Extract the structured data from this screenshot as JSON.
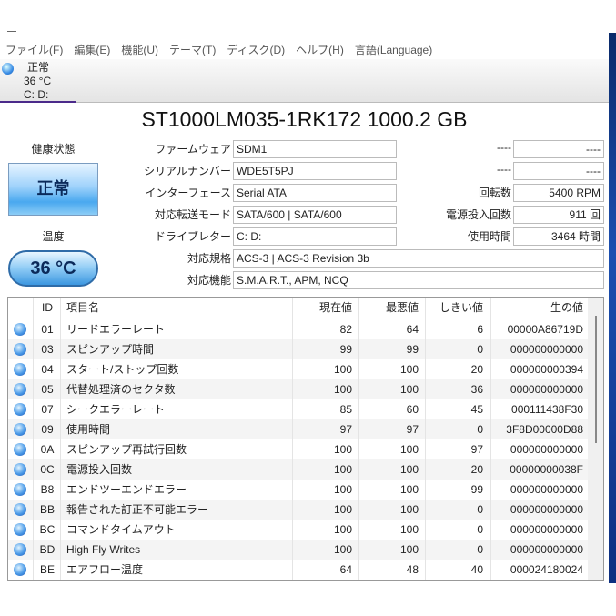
{
  "menu": [
    "ファイル(F)",
    "編集(E)",
    "機能(U)",
    "テーマ(T)",
    "ディスク(D)",
    "ヘルプ(H)",
    "言語(Language)"
  ],
  "disk_tab": {
    "status": "正常",
    "temp": "36 °C",
    "drives": "C: D:"
  },
  "model": "ST1000LM035-1RK172 1000.2 GB",
  "health": {
    "label": "健康状態",
    "value": "正常",
    "color": "#49a8ef"
  },
  "temperature": {
    "label": "温度",
    "value": "36 °C"
  },
  "info": {
    "firmware": {
      "label": "ファームウェア",
      "value": "SDM1"
    },
    "serial": {
      "label": "シリアルナンバー",
      "value": "WDE5T5PJ"
    },
    "interface": {
      "label": "インターフェース",
      "value": "Serial ATA"
    },
    "transfer": {
      "label": "対応転送モード",
      "value": "SATA/600 | SATA/600"
    },
    "letters": {
      "label": "ドライブレター",
      "value": "C: D:"
    },
    "standard": {
      "label": "対応規格",
      "value": "ACS-3 | ACS-3 Revision 3b"
    },
    "features": {
      "label": "対応機能",
      "value": "S.M.A.R.T., APM, NCQ"
    },
    "r1": {
      "label": "----",
      "value": "----"
    },
    "r2": {
      "label": "----",
      "value": "----"
    },
    "rpm": {
      "label": "回転数",
      "value": "5400 RPM"
    },
    "power_count": {
      "label": "電源投入回数",
      "value": "911 回"
    },
    "hours": {
      "label": "使用時間",
      "value": "3464 時間"
    }
  },
  "smart": {
    "headers": {
      "id": "ID",
      "name": "項目名",
      "current": "現在値",
      "worst": "最悪値",
      "threshold": "しきい値",
      "raw": "生の値"
    },
    "rows": [
      {
        "id": "01",
        "name": "リードエラーレート",
        "current": "82",
        "worst": "64",
        "threshold": "6",
        "raw": "00000A86719D"
      },
      {
        "id": "03",
        "name": "スピンアップ時間",
        "current": "99",
        "worst": "99",
        "threshold": "0",
        "raw": "000000000000"
      },
      {
        "id": "04",
        "name": "スタート/ストップ回数",
        "current": "100",
        "worst": "100",
        "threshold": "20",
        "raw": "000000000394"
      },
      {
        "id": "05",
        "name": "代替処理済のセクタ数",
        "current": "100",
        "worst": "100",
        "threshold": "36",
        "raw": "000000000000"
      },
      {
        "id": "07",
        "name": "シークエラーレート",
        "current": "85",
        "worst": "60",
        "threshold": "45",
        "raw": "000111438F30"
      },
      {
        "id": "09",
        "name": "使用時間",
        "current": "97",
        "worst": "97",
        "threshold": "0",
        "raw": "3F8D00000D88"
      },
      {
        "id": "0A",
        "name": "スピンアップ再試行回数",
        "current": "100",
        "worst": "100",
        "threshold": "97",
        "raw": "000000000000"
      },
      {
        "id": "0C",
        "name": "電源投入回数",
        "current": "100",
        "worst": "100",
        "threshold": "20",
        "raw": "00000000038F"
      },
      {
        "id": "B8",
        "name": "エンドツーエンドエラー",
        "current": "100",
        "worst": "100",
        "threshold": "99",
        "raw": "000000000000"
      },
      {
        "id": "BB",
        "name": "報告された訂正不可能エラー",
        "current": "100",
        "worst": "100",
        "threshold": "0",
        "raw": "000000000000"
      },
      {
        "id": "BC",
        "name": "コマンドタイムアウト",
        "current": "100",
        "worst": "100",
        "threshold": "0",
        "raw": "000000000000"
      },
      {
        "id": "BD",
        "name": "High Fly Writes",
        "current": "100",
        "worst": "100",
        "threshold": "0",
        "raw": "000000000000"
      },
      {
        "id": "BE",
        "name": "エアフロー温度",
        "current": "64",
        "worst": "48",
        "threshold": "40",
        "raw": "000024180024"
      }
    ]
  }
}
